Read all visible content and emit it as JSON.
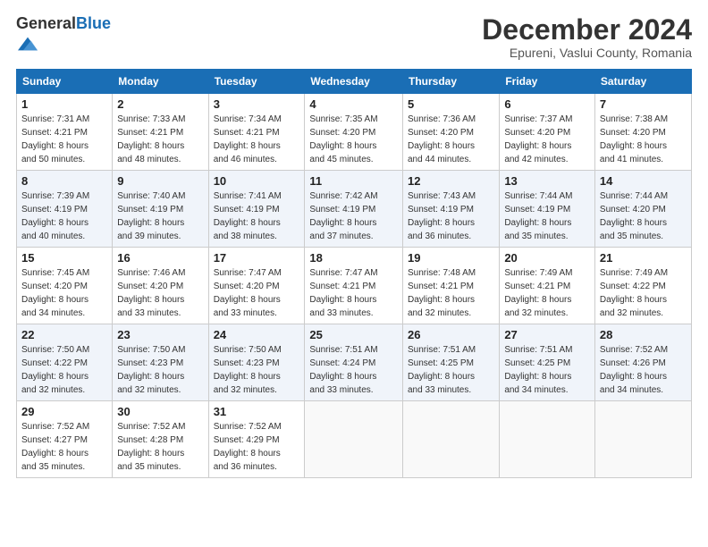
{
  "logo": {
    "general": "General",
    "blue": "Blue"
  },
  "header": {
    "month": "December 2024",
    "location": "Epureni, Vaslui County, Romania"
  },
  "weekdays": [
    "Sunday",
    "Monday",
    "Tuesday",
    "Wednesday",
    "Thursday",
    "Friday",
    "Saturday"
  ],
  "weeks": [
    [
      {
        "day": "1",
        "sunrise": "7:31 AM",
        "sunset": "4:21 PM",
        "daylight": "8 hours and 50 minutes."
      },
      {
        "day": "2",
        "sunrise": "7:33 AM",
        "sunset": "4:21 PM",
        "daylight": "8 hours and 48 minutes."
      },
      {
        "day": "3",
        "sunrise": "7:34 AM",
        "sunset": "4:21 PM",
        "daylight": "8 hours and 46 minutes."
      },
      {
        "day": "4",
        "sunrise": "7:35 AM",
        "sunset": "4:20 PM",
        "daylight": "8 hours and 45 minutes."
      },
      {
        "day": "5",
        "sunrise": "7:36 AM",
        "sunset": "4:20 PM",
        "daylight": "8 hours and 44 minutes."
      },
      {
        "day": "6",
        "sunrise": "7:37 AM",
        "sunset": "4:20 PM",
        "daylight": "8 hours and 42 minutes."
      },
      {
        "day": "7",
        "sunrise": "7:38 AM",
        "sunset": "4:20 PM",
        "daylight": "8 hours and 41 minutes."
      }
    ],
    [
      {
        "day": "8",
        "sunrise": "7:39 AM",
        "sunset": "4:19 PM",
        "daylight": "8 hours and 40 minutes."
      },
      {
        "day": "9",
        "sunrise": "7:40 AM",
        "sunset": "4:19 PM",
        "daylight": "8 hours and 39 minutes."
      },
      {
        "day": "10",
        "sunrise": "7:41 AM",
        "sunset": "4:19 PM",
        "daylight": "8 hours and 38 minutes."
      },
      {
        "day": "11",
        "sunrise": "7:42 AM",
        "sunset": "4:19 PM",
        "daylight": "8 hours and 37 minutes."
      },
      {
        "day": "12",
        "sunrise": "7:43 AM",
        "sunset": "4:19 PM",
        "daylight": "8 hours and 36 minutes."
      },
      {
        "day": "13",
        "sunrise": "7:44 AM",
        "sunset": "4:19 PM",
        "daylight": "8 hours and 35 minutes."
      },
      {
        "day": "14",
        "sunrise": "7:44 AM",
        "sunset": "4:20 PM",
        "daylight": "8 hours and 35 minutes."
      }
    ],
    [
      {
        "day": "15",
        "sunrise": "7:45 AM",
        "sunset": "4:20 PM",
        "daylight": "8 hours and 34 minutes."
      },
      {
        "day": "16",
        "sunrise": "7:46 AM",
        "sunset": "4:20 PM",
        "daylight": "8 hours and 33 minutes."
      },
      {
        "day": "17",
        "sunrise": "7:47 AM",
        "sunset": "4:20 PM",
        "daylight": "8 hours and 33 minutes."
      },
      {
        "day": "18",
        "sunrise": "7:47 AM",
        "sunset": "4:21 PM",
        "daylight": "8 hours and 33 minutes."
      },
      {
        "day": "19",
        "sunrise": "7:48 AM",
        "sunset": "4:21 PM",
        "daylight": "8 hours and 32 minutes."
      },
      {
        "day": "20",
        "sunrise": "7:49 AM",
        "sunset": "4:21 PM",
        "daylight": "8 hours and 32 minutes."
      },
      {
        "day": "21",
        "sunrise": "7:49 AM",
        "sunset": "4:22 PM",
        "daylight": "8 hours and 32 minutes."
      }
    ],
    [
      {
        "day": "22",
        "sunrise": "7:50 AM",
        "sunset": "4:22 PM",
        "daylight": "8 hours and 32 minutes."
      },
      {
        "day": "23",
        "sunrise": "7:50 AM",
        "sunset": "4:23 PM",
        "daylight": "8 hours and 32 minutes."
      },
      {
        "day": "24",
        "sunrise": "7:50 AM",
        "sunset": "4:23 PM",
        "daylight": "8 hours and 32 minutes."
      },
      {
        "day": "25",
        "sunrise": "7:51 AM",
        "sunset": "4:24 PM",
        "daylight": "8 hours and 33 minutes."
      },
      {
        "day": "26",
        "sunrise": "7:51 AM",
        "sunset": "4:25 PM",
        "daylight": "8 hours and 33 minutes."
      },
      {
        "day": "27",
        "sunrise": "7:51 AM",
        "sunset": "4:25 PM",
        "daylight": "8 hours and 34 minutes."
      },
      {
        "day": "28",
        "sunrise": "7:52 AM",
        "sunset": "4:26 PM",
        "daylight": "8 hours and 34 minutes."
      }
    ],
    [
      {
        "day": "29",
        "sunrise": "7:52 AM",
        "sunset": "4:27 PM",
        "daylight": "8 hours and 35 minutes."
      },
      {
        "day": "30",
        "sunrise": "7:52 AM",
        "sunset": "4:28 PM",
        "daylight": "8 hours and 35 minutes."
      },
      {
        "day": "31",
        "sunrise": "7:52 AM",
        "sunset": "4:29 PM",
        "daylight": "8 hours and 36 minutes."
      },
      null,
      null,
      null,
      null
    ]
  ],
  "labels": {
    "sunrise": "Sunrise:",
    "sunset": "Sunset:",
    "daylight": "Daylight:"
  }
}
